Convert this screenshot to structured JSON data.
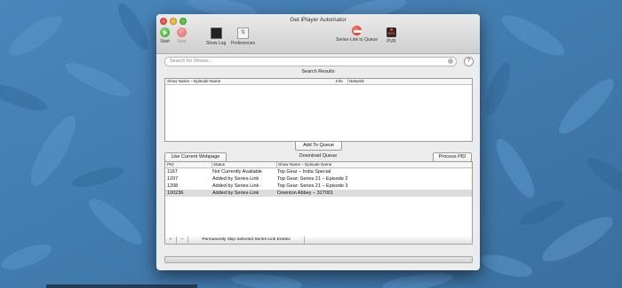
{
  "window": {
    "title": "Get iPlayer Automator"
  },
  "toolbar": {
    "start": "Start",
    "stop": "Stop",
    "show_log": "Show Log",
    "preferences": "Preferences",
    "series_link": "Series-Link to Queue",
    "pvr": "PVR",
    "pvr_icon_text": "REC"
  },
  "search": {
    "placeholder": "Search for Shows..."
  },
  "help_label": "?",
  "results": {
    "heading": "Search Results",
    "columns": [
      "Show Name – Episode Name",
      "Info",
      "Network"
    ]
  },
  "add_to_queue": "Add To Queue",
  "queue": {
    "use_webpage": "Use Current Webpage",
    "heading": "Download Queue",
    "process_pid": "Process PID",
    "columns": [
      "PID",
      "Status",
      "Show Name – Episode Name"
    ],
    "rows": [
      {
        "pid": "1167",
        "status": "Not Currently Available",
        "show": "Top Gear – India Special"
      },
      {
        "pid": "1207",
        "status": "Added by Series-Link",
        "show": "Top Gear: Series 21 – Episode 2"
      },
      {
        "pid": "1208",
        "status": "Added by Series-Link",
        "show": "Top Gear: Series 21 – Episode 3"
      },
      {
        "pid": "100236",
        "status": "Added by Series-Link",
        "show": "Downton Abbey – 327001"
      }
    ],
    "selected_row": 3
  },
  "bottom_bar": {
    "add": "+",
    "remove": "–",
    "skip": "Permanently Skip Selected Series-Link Entries"
  },
  "colors": {
    "desktop": "#3f79ad",
    "close": "#ee5a55",
    "minimize": "#f5bc3b",
    "zoom": "#60c542"
  }
}
